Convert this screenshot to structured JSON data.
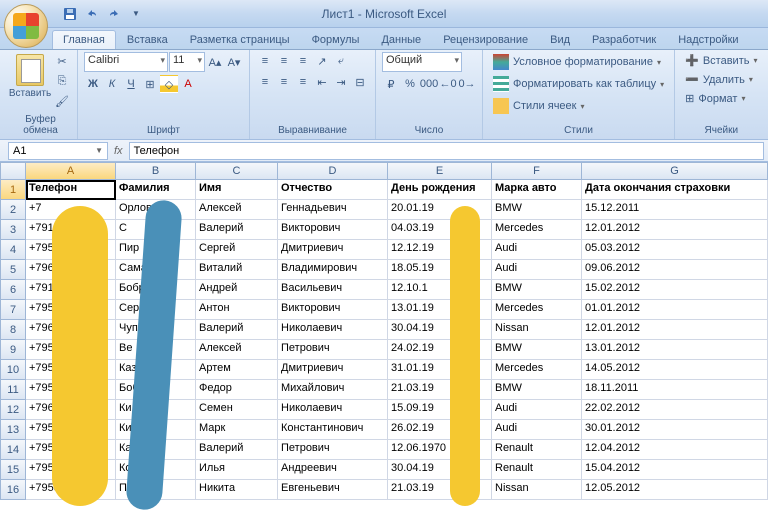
{
  "title": "Лист1 - Microsoft Excel",
  "tabs": [
    "Главная",
    "Вставка",
    "Разметка страницы",
    "Формулы",
    "Данные",
    "Рецензирование",
    "Вид",
    "Разработчик",
    "Надстройки"
  ],
  "active_tab": 0,
  "ribbon": {
    "clipboard": {
      "paste": "Вставить",
      "label": "Буфер обмена"
    },
    "font": {
      "name": "Calibri",
      "size": "11",
      "label": "Шрифт",
      "bold": "Ж",
      "italic": "К",
      "underline": "Ч"
    },
    "align": {
      "label": "Выравнивание"
    },
    "number": {
      "format": "Общий",
      "label": "Число"
    },
    "styles": {
      "cond": "Условное форматирование",
      "table": "Форматировать как таблицу",
      "cell": "Стили ячеек",
      "label": "Стили"
    },
    "cells": {
      "insert": "Вставить",
      "delete": "Удалить",
      "format": "Формат",
      "label": "Ячейки"
    }
  },
  "namebox": "A1",
  "formula": "Телефон",
  "columns": [
    "A",
    "B",
    "C",
    "D",
    "E",
    "F",
    "G"
  ],
  "headers": [
    "Телефон",
    "Фамилия",
    "Имя",
    "Отчество",
    "День рождения",
    "Марка авто",
    "Дата окончания страховки"
  ],
  "chart_data": {
    "type": "table",
    "rows": [
      {
        "phone": "+7",
        "surname": "Орлов",
        "name": "Алексей",
        "patronymic": "Геннадьевич",
        "dob": "20.01.19",
        "car": "BMW",
        "ins": "15.12.2011"
      },
      {
        "phone": "+7911",
        "surname": "С",
        "name": "Валерий",
        "patronymic": "Викторович",
        "dob": "04.03.19",
        "car": "Mercedes",
        "ins": "12.01.2012"
      },
      {
        "phone": "+7951",
        "surname": "Пир",
        "name": "Сергей",
        "patronymic": "Дмитриевич",
        "dob": "12.12.19",
        "car": "Audi",
        "ins": "05.03.2012"
      },
      {
        "phone": "+7963   00",
        "surname": "Самаров",
        "name": "Виталий",
        "patronymic": "Владимирович",
        "dob": "18.05.19",
        "car": "Audi",
        "ins": "09.06.2012"
      },
      {
        "phone": "+79114   0",
        "surname": "Бобров",
        "name": "Андрей",
        "patronymic": "Васильевич",
        "dob": "12.10.1",
        "car": "BMW",
        "ins": "15.02.2012"
      },
      {
        "phone": "+7953  600",
        "surname": "Сериков",
        "name": "Антон",
        "patronymic": "Викторович",
        "dob": "13.01.19",
        "car": "Mercedes",
        "ins": "01.01.2012"
      },
      {
        "phone": "+796",
        "surname": "Чуп",
        "name": "Валерий",
        "patronymic": "Николаевич",
        "dob": "30.04.19",
        "car": "Nissan",
        "ins": "12.01.2012"
      },
      {
        "phone": "+795",
        "surname": "Ве",
        "name": "Алексей",
        "patronymic": "Петрович",
        "dob": "24.02.19",
        "car": "BMW",
        "ins": "13.01.2012"
      },
      {
        "phone": "+7953",
        "surname": "Казанов",
        "name": "Артем",
        "patronymic": "Дмитриевич",
        "dob": "31.01.19",
        "car": "Mercedes",
        "ins": "14.05.2012"
      },
      {
        "phone": "+7953",
        "surname": "Бобриков",
        "name": "Федор",
        "patronymic": "Михайлович",
        "dob": "21.03.19",
        "car": "BMW",
        "ins": "18.11.2011"
      },
      {
        "phone": "+796",
        "surname": "Ки",
        "name": "Семен",
        "patronymic": "Николаевич",
        "dob": "15.09.19",
        "car": "Audi",
        "ins": "22.02.2012"
      },
      {
        "phone": "+7953",
        "surname": "Ки",
        "name": "Марк",
        "patronymic": "Константинович",
        "dob": "26.02.19",
        "car": "Audi",
        "ins": "30.01.2012"
      },
      {
        "phone": "+7953  0",
        "surname": "Карев",
        "name": "Валерий",
        "patronymic": "Петрович",
        "dob": "12.06.1970",
        "car": "Renault",
        "ins": "12.04.2012"
      },
      {
        "phone": "+7953    0",
        "surname": "Ко",
        "name": "Илья",
        "patronymic": "Андреевич",
        "dob": "30.04.19",
        "car": "Renault",
        "ins": "15.04.2012"
      },
      {
        "phone": "+7953",
        "surname": "Проко",
        "name": "Никита",
        "patronymic": "Евгеньевич",
        "dob": "21.03.19",
        "car": "Nissan",
        "ins": "12.05.2012"
      }
    ]
  }
}
